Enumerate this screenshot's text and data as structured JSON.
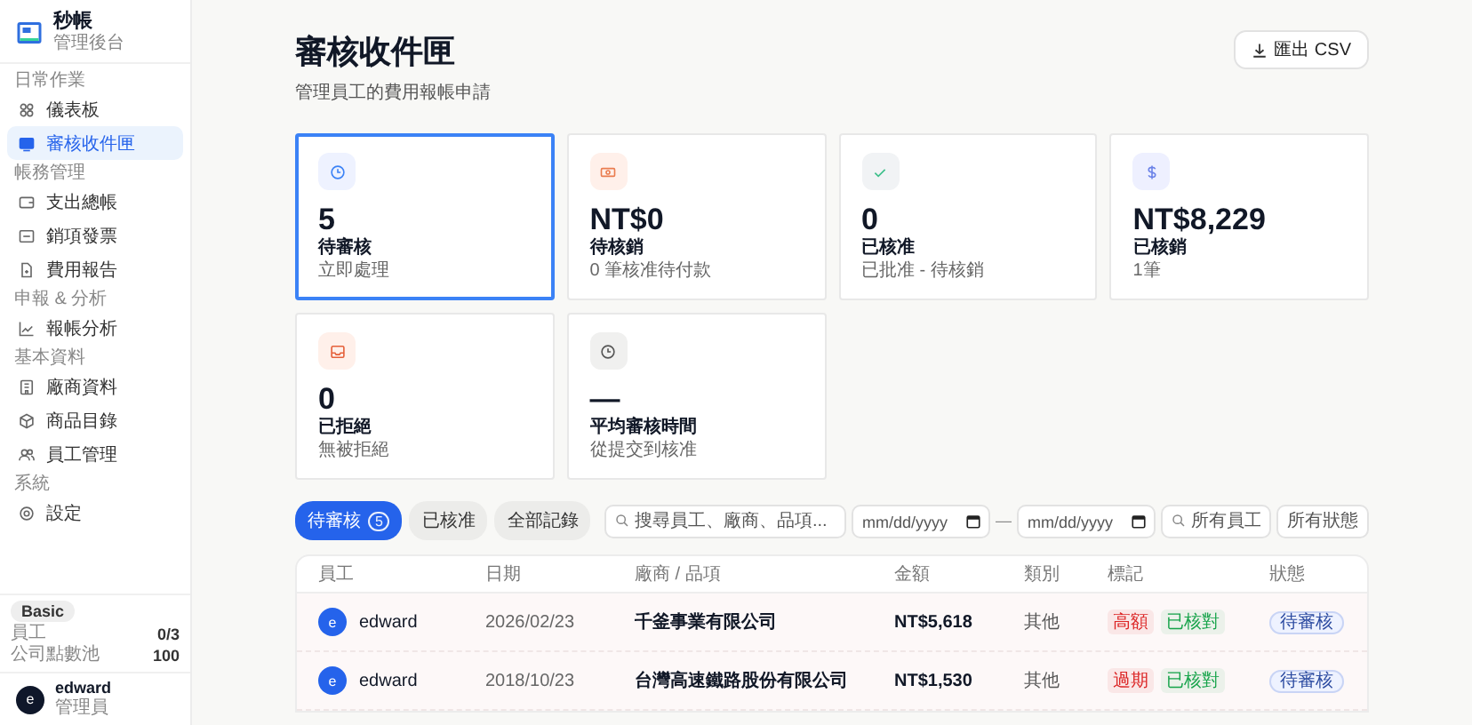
{
  "brand": {
    "name": "秒帳",
    "subtitle": "管理後台"
  },
  "nav": [
    {
      "title": "日常作業",
      "items": [
        {
          "label": "儀表板",
          "selected": false
        },
        {
          "label": "審核收件匣",
          "selected": true
        }
      ]
    },
    {
      "title": "帳務管理",
      "items": [
        {
          "label": "支出總帳",
          "selected": false
        },
        {
          "label": "銷項發票",
          "selected": false
        },
        {
          "label": "費用報告",
          "selected": false
        }
      ]
    },
    {
      "title": "申報 & 分析",
      "items": [
        {
          "label": "報帳分析",
          "selected": false
        }
      ]
    },
    {
      "title": "基本資料",
      "items": [
        {
          "label": "廠商資料",
          "selected": false
        },
        {
          "label": "商品目錄",
          "selected": false
        },
        {
          "label": "員工管理",
          "selected": false
        }
      ]
    },
    {
      "title": "系統",
      "items": [
        {
          "label": "設定",
          "selected": false
        }
      ]
    }
  ],
  "plan": {
    "badge": "Basic",
    "rows": [
      {
        "label": "員工",
        "value": "0/3"
      },
      {
        "label": "公司點數池",
        "value": "100"
      }
    ]
  },
  "user": {
    "avatar": "e",
    "name": "edward",
    "role": "管理員"
  },
  "header": {
    "title": "審核收件匣",
    "subtitle": "管理員工的費用報帳申請",
    "export_button": "匯出 CSV"
  },
  "stats": [
    {
      "value": "5",
      "label": "待審核",
      "note": "立即處理",
      "selected": true
    },
    {
      "value": "NT$0",
      "label": "待核銷",
      "note": "0 筆核准待付款",
      "selected": false
    },
    {
      "value": "0",
      "label": "已核准",
      "note": "已批准 - 待核銷",
      "selected": false
    },
    {
      "value": "NT$8,229",
      "label": "已核銷",
      "note": "1筆",
      "selected": false
    },
    {
      "value": "0",
      "label": "已拒絕",
      "note": "無被拒絕",
      "selected": false
    },
    {
      "value": "—",
      "label": "平均審核時間",
      "note": "從提交到核准",
      "selected": false
    }
  ],
  "tabs": [
    {
      "label": "待審核",
      "count": "5",
      "selected": true
    },
    {
      "label": "已核准",
      "selected": false
    },
    {
      "label": "全部記錄",
      "selected": false
    }
  ],
  "filters": {
    "search_placeholder": "搜尋員工、廠商、品項...",
    "date_from_placeholder": "mm/dd/yyyy",
    "date_separator": "—",
    "date_to_placeholder": "mm/dd/yyyy",
    "employee_placeholder": "所有員工",
    "status_placeholder": "所有狀態"
  },
  "table": {
    "columns": [
      "員工",
      "日期",
      "廠商 / 品項",
      "金額",
      "類別",
      "標記",
      "狀態"
    ],
    "rows": [
      {
        "avatar": "e",
        "employee": "edward",
        "date": "2026/02/23",
        "vendor": "千釜事業有限公司",
        "amount": "NT$5,618",
        "category": "其他",
        "tags": [
          {
            "label": "高額",
            "color": "#dc2626"
          },
          {
            "label": "已核對",
            "color": "#16a34a"
          }
        ],
        "status": "待審核"
      },
      {
        "avatar": "e",
        "employee": "edward",
        "date": "2018/10/23",
        "vendor": "台灣高速鐵路股份有限公司",
        "amount": "NT$1,530",
        "category": "其他",
        "tags": [
          {
            "label": "過期",
            "color": "#dc2626"
          },
          {
            "label": "已核對",
            "color": "#16a34a"
          }
        ],
        "status": "待審核"
      }
    ]
  }
}
